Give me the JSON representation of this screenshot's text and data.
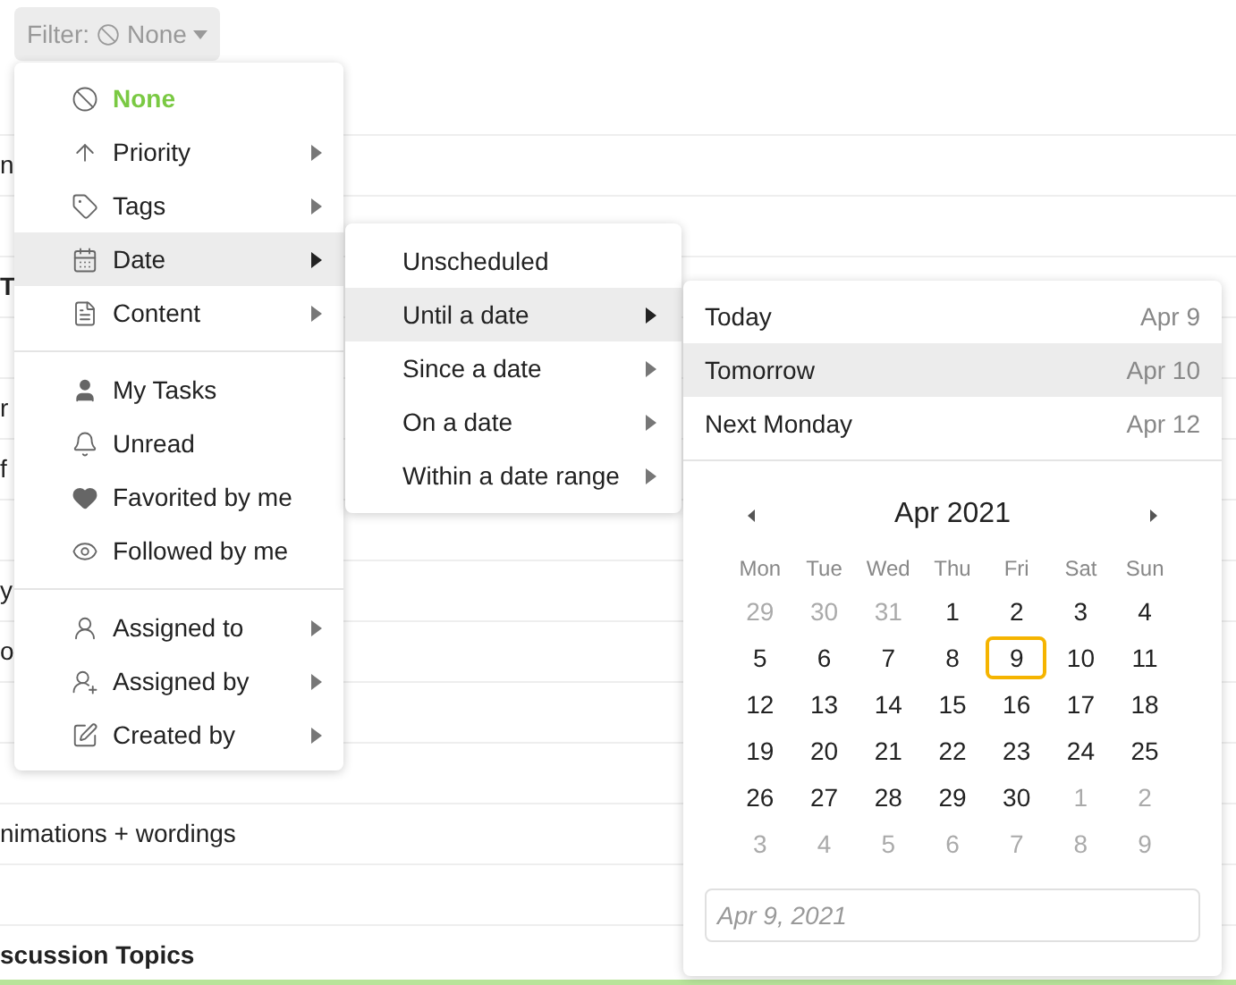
{
  "filter_button": {
    "label": "Filter:",
    "value": "None"
  },
  "background_rows": [
    {
      "text": "n",
      "bold": false
    },
    {},
    {
      "text": "T",
      "bold": true
    },
    {},
    {
      "text": "r",
      "bold": false
    },
    {
      "text": "f",
      "bold": false
    },
    {},
    {
      "text": "y",
      "bold": false
    },
    {
      "text": "o",
      "bold": false
    },
    {},
    {},
    {
      "text": "nimations + wordings",
      "bold": false
    },
    {},
    {
      "text": "scussion Topics",
      "bold": true
    }
  ],
  "filter_menu": {
    "sections": [
      [
        {
          "label": "None",
          "selected": true,
          "submenu": false
        },
        {
          "label": "Priority",
          "selected": false,
          "submenu": true
        },
        {
          "label": "Tags",
          "selected": false,
          "submenu": true
        },
        {
          "label": "Date",
          "selected": true,
          "submenu": true
        },
        {
          "label": "Content",
          "selected": false,
          "submenu": true
        }
      ],
      [
        {
          "label": "My Tasks",
          "selected": false,
          "submenu": false
        },
        {
          "label": "Unread",
          "selected": false,
          "submenu": false
        },
        {
          "label": "Favorited by me",
          "selected": false,
          "submenu": false
        },
        {
          "label": "Followed by me",
          "selected": false,
          "submenu": false
        }
      ],
      [
        {
          "label": "Assigned to",
          "selected": false,
          "submenu": true
        },
        {
          "label": "Assigned by",
          "selected": false,
          "submenu": true
        },
        {
          "label": "Created by",
          "selected": false,
          "submenu": true
        }
      ]
    ]
  },
  "date_menu": [
    {
      "label": "Unscheduled",
      "selected": false,
      "submenu": false
    },
    {
      "label": "Until a date",
      "selected": true,
      "submenu": true
    },
    {
      "label": "Since a date",
      "selected": false,
      "submenu": true
    },
    {
      "label": "On a date",
      "selected": false,
      "submenu": true
    },
    {
      "label": "Within a date range",
      "selected": false,
      "submenu": true
    }
  ],
  "quick_dates": [
    {
      "label": "Today",
      "date": "Apr 9",
      "selected": false
    },
    {
      "label": "Tomorrow",
      "date": "Apr 10",
      "selected": true
    },
    {
      "label": "Next Monday",
      "date": "Apr 12",
      "selected": false
    }
  ],
  "calendar": {
    "month": "Apr 2021",
    "weekdays": [
      "Mon",
      "Tue",
      "Wed",
      "Thu",
      "Fri",
      "Sat",
      "Sun"
    ],
    "days": [
      {
        "label": "29",
        "other_month": true,
        "selected": false
      },
      {
        "label": "30",
        "other_month": true,
        "selected": false
      },
      {
        "label": "31",
        "other_month": true,
        "selected": false
      },
      {
        "label": "1",
        "other_month": false,
        "selected": false
      },
      {
        "label": "2",
        "other_month": false,
        "selected": false
      },
      {
        "label": "3",
        "other_month": false,
        "selected": false
      },
      {
        "label": "4",
        "other_month": false,
        "selected": false
      },
      {
        "label": "5",
        "other_month": false,
        "selected": false
      },
      {
        "label": "6",
        "other_month": false,
        "selected": false
      },
      {
        "label": "7",
        "other_month": false,
        "selected": false
      },
      {
        "label": "8",
        "other_month": false,
        "selected": false
      },
      {
        "label": "9",
        "other_month": false,
        "selected": true
      },
      {
        "label": "10",
        "other_month": false,
        "selected": false
      },
      {
        "label": "11",
        "other_month": false,
        "selected": false
      },
      {
        "label": "12",
        "other_month": false,
        "selected": false
      },
      {
        "label": "13",
        "other_month": false,
        "selected": false
      },
      {
        "label": "14",
        "other_month": false,
        "selected": false
      },
      {
        "label": "15",
        "other_month": false,
        "selected": false
      },
      {
        "label": "16",
        "other_month": false,
        "selected": false
      },
      {
        "label": "17",
        "other_month": false,
        "selected": false
      },
      {
        "label": "18",
        "other_month": false,
        "selected": false
      },
      {
        "label": "19",
        "other_month": false,
        "selected": false
      },
      {
        "label": "20",
        "other_month": false,
        "selected": false
      },
      {
        "label": "21",
        "other_month": false,
        "selected": false
      },
      {
        "label": "22",
        "other_month": false,
        "selected": false
      },
      {
        "label": "23",
        "other_month": false,
        "selected": false
      },
      {
        "label": "24",
        "other_month": false,
        "selected": false
      },
      {
        "label": "25",
        "other_month": false,
        "selected": false
      },
      {
        "label": "26",
        "other_month": false,
        "selected": false
      },
      {
        "label": "27",
        "other_month": false,
        "selected": false
      },
      {
        "label": "28",
        "other_month": false,
        "selected": false
      },
      {
        "label": "29",
        "other_month": false,
        "selected": false
      },
      {
        "label": "30",
        "other_month": false,
        "selected": false
      },
      {
        "label": "1",
        "other_month": true,
        "selected": false
      },
      {
        "label": "2",
        "other_month": true,
        "selected": false
      },
      {
        "label": "3",
        "other_month": true,
        "selected": false
      },
      {
        "label": "4",
        "other_month": true,
        "selected": false
      },
      {
        "label": "5",
        "other_month": true,
        "selected": false
      },
      {
        "label": "6",
        "other_month": true,
        "selected": false
      },
      {
        "label": "7",
        "other_month": true,
        "selected": false
      },
      {
        "label": "8",
        "other_month": true,
        "selected": false
      },
      {
        "label": "9",
        "other_month": true,
        "selected": false
      }
    ],
    "date_field": {
      "placeholder": "Apr 9, 2021"
    }
  }
}
